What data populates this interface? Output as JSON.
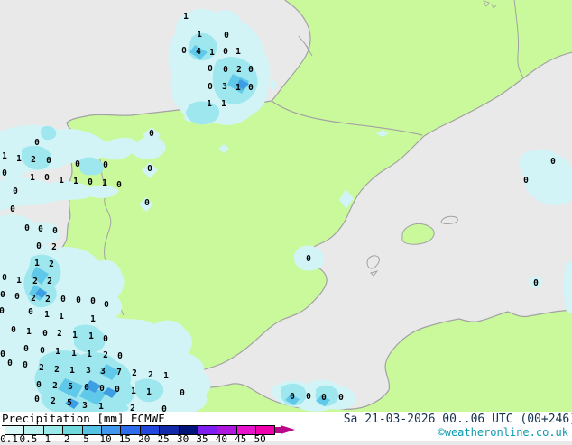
{
  "legend": {
    "title": "Precipitation",
    "unit": "[mm]",
    "model": "ECMWF",
    "scale": {
      "ticks": [
        "0.1",
        "0.5",
        "1",
        "2",
        "5",
        "10",
        "15",
        "20",
        "25",
        "30",
        "35",
        "40",
        "45",
        "50"
      ],
      "colors": [
        "#d9f8f8",
        "#b9f1f1",
        "#9aeaea",
        "#70d9dd",
        "#55c2e6",
        "#4197ee",
        "#2e6cee",
        "#2347de",
        "#1229aa",
        "#001378",
        "#7e1ff2",
        "#ae18de",
        "#e713cd",
        "#f000ad"
      ],
      "arrow_color": "#b8088c"
    }
  },
  "footer": {
    "timestamp": "Sa 21-03-2026 00..06 UTC (00+246)",
    "copyright": "©weatheronline.co.uk"
  },
  "map": {
    "colors": {
      "sea": "#e9e9e9",
      "land": "#caf99c",
      "coast": "#a2a2a2",
      "precip_light": "#d2f4f6",
      "precip_medium": "#9fe7ef",
      "precip_dark": "#60c8e9",
      "precip_heavy": "#3e9ee4"
    },
    "values": [
      [
        206,
        19,
        "1"
      ],
      [
        221,
        39,
        "1"
      ],
      [
        251,
        40,
        "0"
      ],
      [
        204,
        57,
        "0"
      ],
      [
        220,
        58,
        "4"
      ],
      [
        235,
        59,
        "1"
      ],
      [
        250,
        58,
        "0"
      ],
      [
        264,
        58,
        "1"
      ],
      [
        233,
        77,
        "0"
      ],
      [
        250,
        78,
        "0"
      ],
      [
        265,
        78,
        "2"
      ],
      [
        278,
        78,
        "0"
      ],
      [
        233,
        97,
        "0"
      ],
      [
        249,
        97,
        "3"
      ],
      [
        264,
        98,
        "1"
      ],
      [
        278,
        98,
        "0"
      ],
      [
        232,
        116,
        "1"
      ],
      [
        248,
        116,
        "1"
      ],
      [
        41,
        159,
        "0"
      ],
      [
        5,
        174,
        "1"
      ],
      [
        21,
        177,
        "1"
      ],
      [
        37,
        178,
        "2"
      ],
      [
        54,
        179,
        "0"
      ],
      [
        86,
        183,
        "0"
      ],
      [
        117,
        184,
        "0"
      ],
      [
        5,
        193,
        "0"
      ],
      [
        36,
        198,
        "1"
      ],
      [
        52,
        198,
        "0"
      ],
      [
        68,
        201,
        "1"
      ],
      [
        84,
        202,
        "1"
      ],
      [
        100,
        203,
        "0"
      ],
      [
        116,
        204,
        "1"
      ],
      [
        132,
        206,
        "0"
      ],
      [
        17,
        213,
        "0"
      ],
      [
        14,
        233,
        "0"
      ],
      [
        30,
        254,
        "0"
      ],
      [
        45,
        255,
        "0"
      ],
      [
        61,
        257,
        "0"
      ],
      [
        43,
        274,
        "0"
      ],
      [
        60,
        275,
        "2"
      ],
      [
        168,
        149,
        "0"
      ],
      [
        166,
        188,
        "0"
      ],
      [
        163,
        226,
        "0"
      ],
      [
        41,
        293,
        "1"
      ],
      [
        57,
        294,
        "2"
      ],
      [
        5,
        309,
        "0"
      ],
      [
        21,
        312,
        "1"
      ],
      [
        39,
        313,
        "2"
      ],
      [
        55,
        313,
        "2"
      ],
      [
        3,
        328,
        "0"
      ],
      [
        19,
        330,
        "0"
      ],
      [
        37,
        332,
        "2"
      ],
      [
        53,
        333,
        "2"
      ],
      [
        70,
        333,
        "0"
      ],
      [
        87,
        334,
        "0"
      ],
      [
        103,
        335,
        "0"
      ],
      [
        118,
        339,
        "0"
      ],
      [
        2,
        346,
        "0"
      ],
      [
        34,
        347,
        "0"
      ],
      [
        52,
        350,
        "1"
      ],
      [
        68,
        352,
        "1"
      ],
      [
        103,
        355,
        "1"
      ],
      [
        15,
        367,
        "0"
      ],
      [
        32,
        369,
        "1"
      ],
      [
        50,
        371,
        "0"
      ],
      [
        66,
        371,
        "2"
      ],
      [
        83,
        373,
        "1"
      ],
      [
        101,
        374,
        "1"
      ],
      [
        117,
        377,
        "0"
      ],
      [
        3,
        394,
        "0"
      ],
      [
        29,
        388,
        "0"
      ],
      [
        47,
        390,
        "0"
      ],
      [
        64,
        391,
        "1"
      ],
      [
        82,
        393,
        "1"
      ],
      [
        99,
        394,
        "1"
      ],
      [
        117,
        395,
        "2"
      ],
      [
        133,
        396,
        "0"
      ],
      [
        11,
        404,
        "0"
      ],
      [
        28,
        406,
        "0"
      ],
      [
        46,
        409,
        "2"
      ],
      [
        63,
        411,
        "2"
      ],
      [
        80,
        412,
        "1"
      ],
      [
        98,
        412,
        "3"
      ],
      [
        114,
        413,
        "3"
      ],
      [
        132,
        414,
        "7"
      ],
      [
        149,
        415,
        "2"
      ],
      [
        167,
        417,
        "2"
      ],
      [
        184,
        418,
        "1"
      ],
      [
        43,
        428,
        "0"
      ],
      [
        61,
        429,
        "2"
      ],
      [
        78,
        430,
        "5"
      ],
      [
        96,
        431,
        "0"
      ],
      [
        113,
        432,
        "0"
      ],
      [
        130,
        433,
        "0"
      ],
      [
        148,
        435,
        "1"
      ],
      [
        165,
        436,
        "1"
      ],
      [
        202,
        437,
        "0"
      ],
      [
        41,
        444,
        "0"
      ],
      [
        59,
        446,
        "2"
      ],
      [
        77,
        448,
        "5"
      ],
      [
        94,
        451,
        "3"
      ],
      [
        112,
        452,
        "1"
      ],
      [
        147,
        454,
        "2"
      ],
      [
        182,
        455,
        "0"
      ],
      [
        342,
        288,
        "0"
      ],
      [
        594,
        315,
        "0"
      ],
      [
        583,
        201,
        "0"
      ],
      [
        613,
        180,
        "0"
      ],
      [
        324,
        441,
        "0"
      ],
      [
        342,
        441,
        "0"
      ],
      [
        359,
        442,
        "0"
      ],
      [
        378,
        442,
        "0"
      ]
    ]
  }
}
